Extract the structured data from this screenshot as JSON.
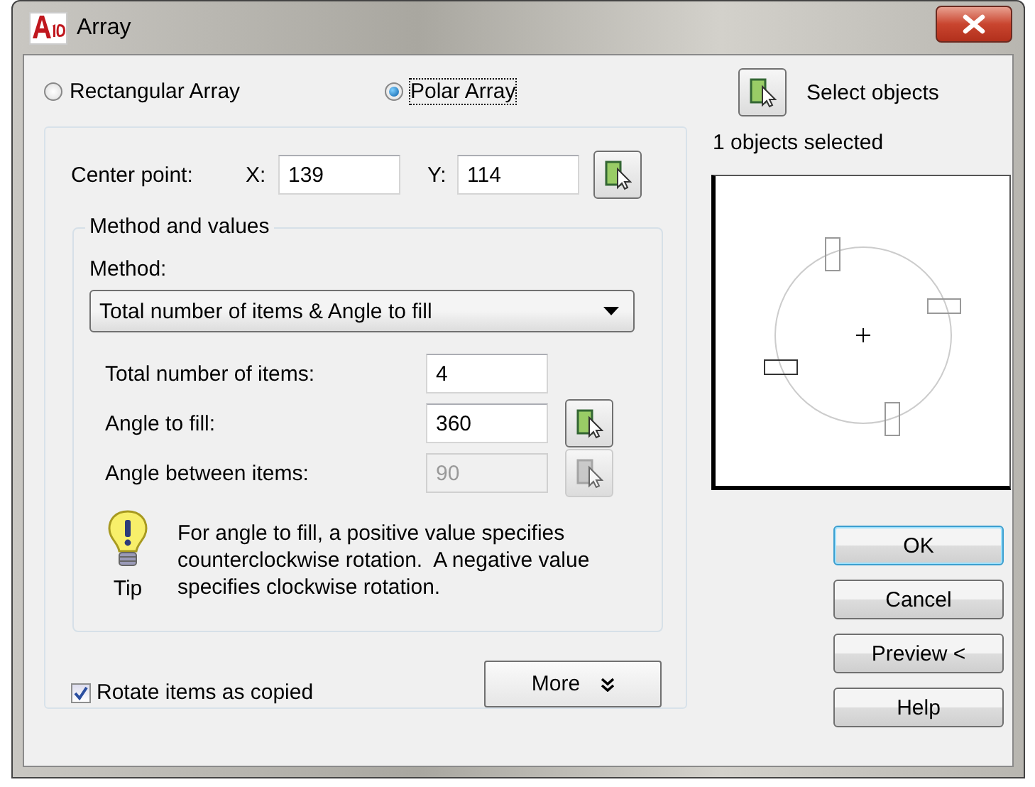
{
  "window": {
    "title": "Array"
  },
  "array_type": [
    {
      "label": "Rectangular Array",
      "selected": false
    },
    {
      "label": "Polar Array",
      "selected": true
    }
  ],
  "center_point": {
    "label": "Center point:",
    "x_label": "X:",
    "x_value": "139",
    "y_label": "Y:",
    "y_value": "114"
  },
  "method_group": {
    "title": "Method and values",
    "method_label": "Method:",
    "method_value": "Total number of items & Angle to fill",
    "fields": [
      {
        "label": "Total number of items:",
        "value": "4",
        "disabled": false,
        "pick_button": false
      },
      {
        "label": "Angle to fill:",
        "value": "360",
        "disabled": false,
        "pick_button": true
      },
      {
        "label": "Angle between items:",
        "value": "90",
        "disabled": true,
        "pick_button": true
      }
    ],
    "tip": {
      "label": "Tip",
      "text": "For angle to fill, a positive value specifies counterclockwise rotation.  A negative value specifies clockwise rotation."
    }
  },
  "rotate_items": {
    "label": "Rotate items as copied",
    "checked": true
  },
  "more_button": {
    "label": "More"
  },
  "select_objects": {
    "label": "Select objects",
    "status": "1 objects selected"
  },
  "buttons": [
    {
      "label": "OK",
      "default": true
    },
    {
      "label": "Cancel",
      "default": false
    },
    {
      "label": "Preview <",
      "default": false
    },
    {
      "label": "Help",
      "default": false
    }
  ]
}
